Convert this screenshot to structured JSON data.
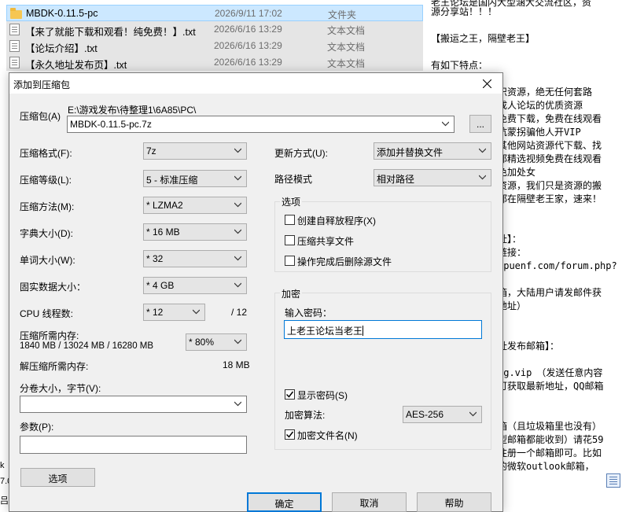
{
  "files": [
    {
      "name": "MBDK-0.11.5-pc",
      "date": "2026/9/11 17:02",
      "type": "文件夹",
      "icon": "folder-icon"
    },
    {
      "name": "【来了就能下载和观看！纯免费！】.txt",
      "date": "2026/6/16 13:29",
      "type": "文本文档",
      "icon": "text-file-icon"
    },
    {
      "name": "【论坛介绍】.txt",
      "date": "2026/6/16 13:29",
      "type": "文本文档",
      "icon": "text-file-icon"
    },
    {
      "name": "【永久地址发布页】.txt",
      "date": "2026/6/16 13:29",
      "type": "文本文档",
      "icon": "text-file-icon"
    }
  ],
  "notepad": {
    "lines": [
      "老王论坛是国内大型涵大交流社区，资",
      "源分享站！！！",
      "【搬运之王，隔壁老王】",
      "有如下特点：",
      "识资源，绝无任何套路",
      "成人论坛的优质资源",
      "免费下载，免费在线观看",
      "坑蒙拐骗他人开VIP",
      "其他网站资源代下载、找",
      "都精选视频免费在线观看",
      "色加处女",
      "资源，我们只是资源的搬",
      "都在隔壁老王家，速来！",
      "址】：",
      "链接：",
      "gpuenf.com/forum.php?",
      "箱，大陆用户请发邮件获",
      "地址）",
      "址发布邮箱】：",
      "ng.vip　（发送任意内容",
      "可获取最新地址，QQ邮箱",
      "箱（且垃圾箱里也没有）",
      "型邮箱都能收到）请花59",
      "注册一个邮箱即可。比如",
      "的微软outlook邮箱，"
    ]
  },
  "edge": {
    "a": "k",
    "b": "7.0",
    "c": "吕"
  },
  "dialog": {
    "title": "添加到压缩包",
    "archive_label": "压缩包(A)",
    "archive_path": "E:\\游戏发布\\待整理1\\6A85\\PC\\",
    "archive_name": "MBDK-0.11.5-pc.7z",
    "browse_label": "...",
    "format_label": "压缩格式(F):",
    "format_value": "7z",
    "level_label": "压缩等级(L):",
    "level_value": "5 - 标准压缩",
    "method_label": "压缩方法(M):",
    "method_value": "* LZMA2",
    "dict_label": "字典大小(D):",
    "dict_value": "* 16 MB",
    "word_label": "单词大小(W):",
    "word_value": "* 32",
    "solid_label": "固实数据大小：",
    "solid_value": "* 4 GB",
    "cpu_label": "CPU 线程数:",
    "cpu_value": "* 12",
    "cpu_total": "/ 12",
    "mem_label": "压缩所需内存:",
    "mem_value": "1840 MB / 13024 MB / 16280 MB",
    "mem_percent": "* 80%",
    "decomp_label": "解压缩所需内存:",
    "decomp_value": "18 MB",
    "split_label": "分卷大小，字节(V):",
    "split_value": "",
    "params_label": "参数(P):",
    "params_value": "",
    "options_button": "选项",
    "update_label": "更新方式(U):",
    "update_value": "添加并替换文件",
    "path_label": "路径模式",
    "path_value": "相对路径",
    "options_group": "选项",
    "opt_sfx": "创建自释放程序(X)",
    "opt_shared": "压缩共享文件",
    "opt_delete": "操作完成后删除源文件",
    "encrypt_group": "加密",
    "password_label": "输入密码：",
    "password_value": "上老王论坛当老王",
    "show_password": "显示密码(S)",
    "encrypt_method_label": "加密算法:",
    "encrypt_method_value": "AES-256",
    "encrypt_names": "加密文件名(N)",
    "ok": "确定",
    "cancel": "取消",
    "help": "帮助"
  }
}
